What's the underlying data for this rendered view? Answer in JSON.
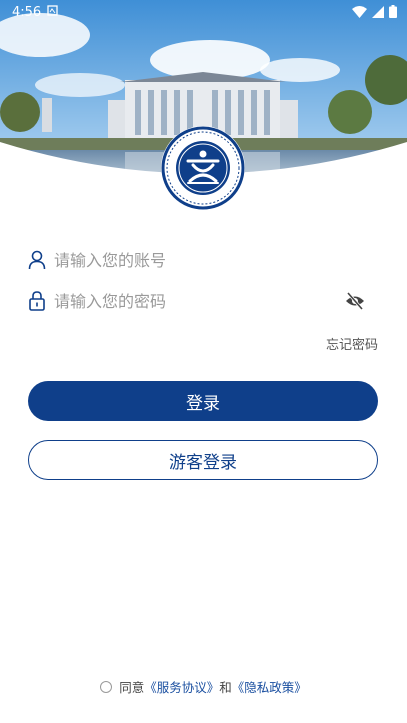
{
  "status_bar": {
    "time": "4:56"
  },
  "login": {
    "account_placeholder": "请输入您的账号",
    "password_placeholder": "请输入您的密码",
    "forgot_password": "忘记密码",
    "login_button": "登录",
    "guest_button": "游客登录"
  },
  "agreement": {
    "prefix": "同意",
    "service_link": "《服务协议》",
    "conjunction": "和",
    "privacy_link": "《隐私政策》"
  },
  "colors": {
    "primary": "#0f3f8a",
    "link": "#1a4fa0"
  },
  "icons": [
    "user-icon",
    "lock-icon",
    "eye-off-icon",
    "wifi-icon",
    "signal-icon",
    "battery-icon"
  ]
}
